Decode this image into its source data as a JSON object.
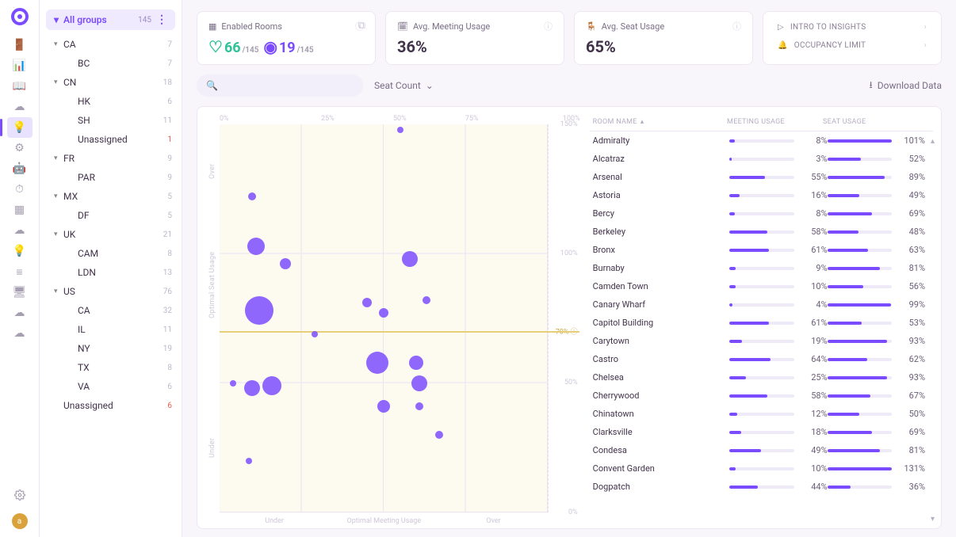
{
  "rail": {
    "icons": [
      "door-icon",
      "dashboard-icon",
      "book-icon",
      "cloud-icon",
      "bulb-icon",
      "sliders-icon",
      "robot-icon",
      "gauge-icon",
      "layout-icon",
      "cloud2-icon",
      "bulb2-icon",
      "sliders2-icon",
      "monitor-icon",
      "cloud3-icon",
      "cloud4-icon"
    ],
    "active_index": 4,
    "avatar_initial": "a"
  },
  "groups": {
    "header_label": "All groups",
    "header_count": "145",
    "items": [
      {
        "type": "group",
        "name": "CA",
        "count": "7"
      },
      {
        "type": "leaf",
        "name": "BC",
        "count": "7"
      },
      {
        "type": "group",
        "name": "CN",
        "count": "18"
      },
      {
        "type": "leaf",
        "name": "HK",
        "count": "6"
      },
      {
        "type": "leaf",
        "name": "SH",
        "count": "11"
      },
      {
        "type": "leaf",
        "name": "Unassigned",
        "count": "1",
        "warn": true
      },
      {
        "type": "group",
        "name": "FR",
        "count": "9"
      },
      {
        "type": "leaf",
        "name": "PAR",
        "count": "9"
      },
      {
        "type": "group",
        "name": "MX",
        "count": "5"
      },
      {
        "type": "leaf",
        "name": "DF",
        "count": "5"
      },
      {
        "type": "group",
        "name": "UK",
        "count": "21"
      },
      {
        "type": "leaf",
        "name": "CAM",
        "count": "8"
      },
      {
        "type": "leaf",
        "name": "LDN",
        "count": "13"
      },
      {
        "type": "group",
        "name": "US",
        "count": "76"
      },
      {
        "type": "leaf",
        "name": "CA",
        "count": "32"
      },
      {
        "type": "leaf",
        "name": "IL",
        "count": "11"
      },
      {
        "type": "leaf",
        "name": "NY",
        "count": "19"
      },
      {
        "type": "leaf",
        "name": "TX",
        "count": "8"
      },
      {
        "type": "leaf",
        "name": "VA",
        "count": "6"
      },
      {
        "type": "leaf",
        "name": "Unassigned",
        "count": "6",
        "warn": true,
        "root": true
      }
    ]
  },
  "cards": {
    "enabled": {
      "title": "Enabled Rooms",
      "good_n": "66",
      "good_d": "/145",
      "bad_n": "19",
      "bad_d": "/145"
    },
    "meeting": {
      "title": "Avg. Meeting Usage",
      "value": "36%"
    },
    "seat": {
      "title": "Avg. Seat Usage",
      "value": "65%"
    },
    "insights": [
      {
        "icon": "play-icon",
        "label": "INTRO TO INSIGHTS"
      },
      {
        "icon": "bell-icon",
        "label": "OCCUPANCY LIMIT"
      }
    ]
  },
  "toolbar": {
    "filter_label": "Seat Count",
    "download_label": "Download Data"
  },
  "chart": {
    "x_ticks": [
      "0%",
      "25%",
      "50%",
      "75%",
      "100%"
    ],
    "y_right": [
      "150%",
      "100%",
      "70%",
      "50%",
      "0%"
    ],
    "target_label": "70%",
    "y_sections": [
      "Over",
      "Optimal Seat Usage",
      "Under"
    ],
    "x_sections": [
      "Under",
      "Optimal Meeting Usage",
      "Over"
    ]
  },
  "table": {
    "headers": {
      "name": "ROOM NAME",
      "meeting": "MEETING USAGE",
      "seat": "SEAT USAGE"
    },
    "rows": [
      {
        "name": "Admiralty",
        "meeting": 8,
        "seat": 101
      },
      {
        "name": "Alcatraz",
        "meeting": 3,
        "seat": 52
      },
      {
        "name": "Arsenal",
        "meeting": 55,
        "seat": 89
      },
      {
        "name": "Astoria",
        "meeting": 16,
        "seat": 49
      },
      {
        "name": "Bercy",
        "meeting": 8,
        "seat": 69
      },
      {
        "name": "Berkeley",
        "meeting": 58,
        "seat": 48
      },
      {
        "name": "Bronx",
        "meeting": 61,
        "seat": 63
      },
      {
        "name": "Burnaby",
        "meeting": 9,
        "seat": 81
      },
      {
        "name": "Camden Town",
        "meeting": 10,
        "seat": 56
      },
      {
        "name": "Canary Wharf",
        "meeting": 4,
        "seat": 99
      },
      {
        "name": "Capitol Building",
        "meeting": 61,
        "seat": 53
      },
      {
        "name": "Carytown",
        "meeting": 19,
        "seat": 93
      },
      {
        "name": "Castro",
        "meeting": 64,
        "seat": 62
      },
      {
        "name": "Chelsea",
        "meeting": 25,
        "seat": 93
      },
      {
        "name": "Cherrywood",
        "meeting": 58,
        "seat": 67
      },
      {
        "name": "Chinatown",
        "meeting": 12,
        "seat": 50
      },
      {
        "name": "Clarksville",
        "meeting": 18,
        "seat": 69
      },
      {
        "name": "Condesa",
        "meeting": 49,
        "seat": 81
      },
      {
        "name": "Convent Garden",
        "meeting": 10,
        "seat": 131
      },
      {
        "name": "Dogpatch",
        "meeting": 44,
        "seat": 36
      }
    ]
  },
  "chart_data": {
    "type": "scatter",
    "xlabel": "Meeting Usage",
    "ylabel": "Seat Usage",
    "xlim": [
      0,
      100
    ],
    "ylim": [
      0,
      150
    ],
    "target_y": 70,
    "size_encodes": "Seat Count",
    "x_sections": [
      "Under",
      "Optimal Meeting Usage",
      "Over"
    ],
    "y_sections": [
      "Under",
      "Optimal Seat Usage",
      "Over"
    ],
    "points": [
      {
        "x": 55,
        "y": 148,
        "size": 8
      },
      {
        "x": 10,
        "y": 122,
        "size": 10
      },
      {
        "x": 11,
        "y": 103,
        "size": 22
      },
      {
        "x": 20,
        "y": 96,
        "size": 14
      },
      {
        "x": 58,
        "y": 98,
        "size": 20
      },
      {
        "x": 45,
        "y": 81,
        "size": 12
      },
      {
        "x": 50,
        "y": 77,
        "size": 12
      },
      {
        "x": 63,
        "y": 82,
        "size": 10
      },
      {
        "x": 12,
        "y": 78,
        "size": 36
      },
      {
        "x": 29,
        "y": 69,
        "size": 8
      },
      {
        "x": 48,
        "y": 58,
        "size": 28
      },
      {
        "x": 60,
        "y": 58,
        "size": 18
      },
      {
        "x": 61,
        "y": 50,
        "size": 20
      },
      {
        "x": 16,
        "y": 49,
        "size": 24
      },
      {
        "x": 10,
        "y": 48,
        "size": 20
      },
      {
        "x": 4,
        "y": 50,
        "size": 8
      },
      {
        "x": 50,
        "y": 41,
        "size": 16
      },
      {
        "x": 61,
        "y": 41,
        "size": 10
      },
      {
        "x": 67,
        "y": 30,
        "size": 10
      },
      {
        "x": 9,
        "y": 20,
        "size": 8
      }
    ]
  }
}
